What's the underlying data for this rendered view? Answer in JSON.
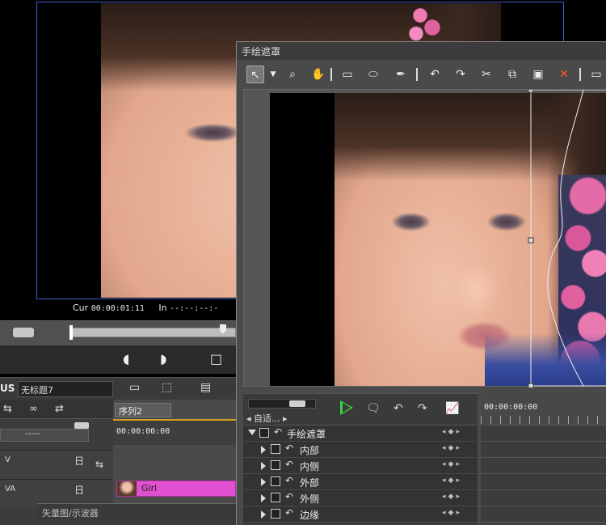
{
  "player": {
    "cur_label": "Cur",
    "cur_value": "00:00:01:11",
    "in_label": "In",
    "in_value": "--:--:--:-"
  },
  "project": {
    "logo": "US",
    "name": "无标题7",
    "sequence_tab": "序列2",
    "ruler_timecode": "00:00:00:00",
    "dropdown_value": "-----",
    "tracks": [
      {
        "name": "V"
      },
      {
        "name": "VA"
      }
    ],
    "clip_name": "Girl",
    "scope_panel": "矢量图/示波器"
  },
  "dialog": {
    "title": "手绘遮罩",
    "selector": "自适...",
    "kf_timecode": "00:00:00:00",
    "tree": [
      {
        "label": "手绘遮罩",
        "level": 0
      },
      {
        "label": "内部",
        "level": 1
      },
      {
        "label": "内侧",
        "level": 1
      },
      {
        "label": "外部",
        "level": 1
      },
      {
        "label": "外侧",
        "level": 1
      },
      {
        "label": "边缘",
        "level": 1
      }
    ]
  },
  "colors": {
    "player_border": "#3f5fd0",
    "clip_color": "#e050d0",
    "play_button": "#36d040",
    "delete_icon": "#ff5a1e"
  },
  "icons": [
    "pointer-icon",
    "zoom-icon",
    "hand-icon",
    "rectangle-icon",
    "ellipse-icon",
    "pen-icon",
    "undo-icon",
    "redo-icon",
    "cut-icon",
    "copy-icon",
    "paste-icon",
    "delete-icon"
  ]
}
